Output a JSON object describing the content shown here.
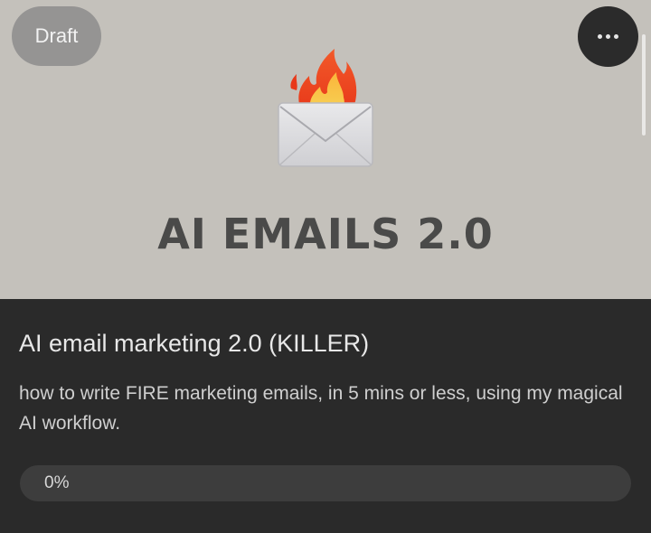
{
  "cover": {
    "badge": "Draft",
    "menu_icon": "more-horizontal-icon",
    "emoji_icon": "fire-envelope-icon",
    "title": "AI EMAILS 2.0",
    "background_color": "#c4c1bb"
  },
  "course": {
    "title": "AI email marketing 2.0 (KILLER)",
    "description": "how to write FIRE marketing emails, in 5 mins or less, using my magical AI workflow.",
    "progress_label": "0%",
    "progress_fraction": 0
  }
}
